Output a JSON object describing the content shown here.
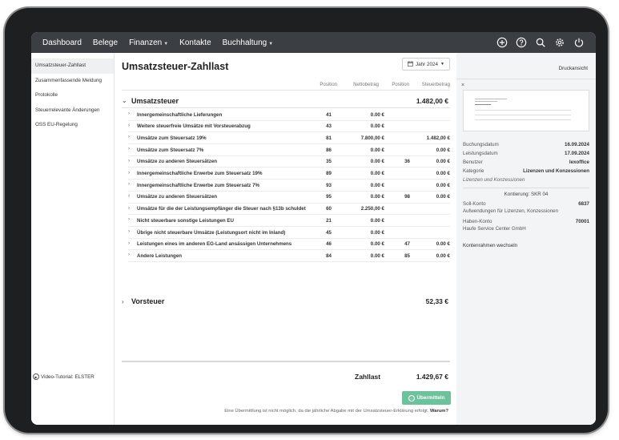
{
  "nav": {
    "items": [
      {
        "label": "Dashboard",
        "caret": false
      },
      {
        "label": "Belege",
        "caret": false
      },
      {
        "label": "Finanzen",
        "caret": true
      },
      {
        "label": "Kontakte",
        "caret": false
      },
      {
        "label": "Buchhaltung",
        "caret": true
      }
    ],
    "icons": [
      "plus-circle-icon",
      "help-icon",
      "search-icon",
      "gear-icon",
      "power-icon"
    ]
  },
  "sidebar": {
    "items": [
      {
        "label": "Umsatzsteuer-Zahllast",
        "active": true
      },
      {
        "label": "Zusammenfassende Meldung",
        "active": false
      },
      {
        "label": "Protokolle",
        "active": false
      },
      {
        "label": "Steuerrelevante Änderungen",
        "active": false
      },
      {
        "label": "OSS EU-Regelung",
        "active": false
      }
    ],
    "footer": "Video-Tutorial: ELSTER"
  },
  "main": {
    "title": "Umsatzsteuer-Zahllast",
    "year_button": "Jahr 2024",
    "columns": {
      "position1": "Position",
      "netto": "Nettobetrag",
      "position2": "Position",
      "steuer": "Steuerbetrag"
    },
    "group1": {
      "label": "Umsatzsteuer",
      "amount": "1.482,00 €"
    },
    "rows": [
      {
        "label": "Innergemeinschaftliche Lieferungen",
        "pos": "41",
        "netto": "0.00 €",
        "pos2": "",
        "steuer": ""
      },
      {
        "label": "Weitere steuerfreie Umsätze mit Vorsteuerabzug",
        "pos": "43",
        "netto": "0.00 €",
        "pos2": "",
        "steuer": ""
      },
      {
        "label": "Umsätze zum Steuersatz 19%",
        "pos": "81",
        "netto": "7.800,00 €",
        "pos2": "",
        "steuer": "1.482,00 €"
      },
      {
        "label": "Umsätze zum Steuersatz 7%",
        "pos": "86",
        "netto": "0.00 €",
        "pos2": "",
        "steuer": "0.00 €"
      },
      {
        "label": "Umsätze zu anderen Steuersätzen",
        "pos": "35",
        "netto": "0.00 €",
        "pos2": "36",
        "steuer": "0.00 €"
      },
      {
        "label": "Innergemeinschaftliche Erwerbe zum Steuersatz 19%",
        "pos": "89",
        "netto": "0.00 €",
        "pos2": "",
        "steuer": "0.00 €"
      },
      {
        "label": "Innergemeinschaftliche Erwerbe zum Steuersatz 7%",
        "pos": "93",
        "netto": "0.00 €",
        "pos2": "",
        "steuer": "0.00 €"
      },
      {
        "label": "Umsätze zu anderen Steuersätzen",
        "pos": "95",
        "netto": "0.00 €",
        "pos2": "98",
        "steuer": "0.00 €"
      },
      {
        "label": "Umsätze für die der Leistungsempfänger die Steuer nach §13b schuldet",
        "pos": "60",
        "netto": "2.250,00 €",
        "pos2": "",
        "steuer": ""
      },
      {
        "label": "Nicht steuerbare sonstige Leistungen EU",
        "pos": "21",
        "netto": "0.00 €",
        "pos2": "",
        "steuer": ""
      },
      {
        "label": "Übrige nicht steuerbare Umsätze (Leistungsort nicht im Inland)",
        "pos": "45",
        "netto": "0.00 €",
        "pos2": "",
        "steuer": ""
      },
      {
        "label": "Leistungen eines im anderen EG-Land ansässigen Unternehmens",
        "pos": "46",
        "netto": "0.00 €",
        "pos2": "47",
        "steuer": "0.00 €"
      },
      {
        "label": "Andere Leistungen",
        "pos": "84",
        "netto": "0.00 €",
        "pos2": "85",
        "steuer": "0.00 €"
      }
    ],
    "group2": {
      "label": "Vorsteuer",
      "amount": "52,33 €"
    },
    "total_label": "Zahllast",
    "total_amount": "1.429,67 €",
    "submit_button": "Übermitteln",
    "note_text": "Eine Übermittlung ist nicht möglich, da die jährliche Abgabe mit der Umsatzsteuer-Erklärung erfolgt.",
    "note_link": "Warum?"
  },
  "right": {
    "print_view": "Druckansicht",
    "close": "×",
    "fields": [
      {
        "key": "Buchungsdatum",
        "value": "16.09.2024"
      },
      {
        "key": "Leistungsdatum",
        "value": "17.09.2024"
      },
      {
        "key": "Benutzer",
        "value": "lexoffice"
      },
      {
        "key": "Kategorie",
        "value": "Lizenzen und Konzessionen"
      }
    ],
    "category_note": "Lizenzen und Konzessionen",
    "kontierung": "Kontierung: SKR 04",
    "soll_label": "Soll-Konto",
    "soll_value": "6837",
    "soll_desc": "Aufwendungen für Lizenzen, Konzessionen",
    "haben_label": "Haben-Konto",
    "haben_value": "70001",
    "haben_desc": "Haufe Service Center GmbH",
    "change_link": "Kontenrahmen wechseln"
  }
}
